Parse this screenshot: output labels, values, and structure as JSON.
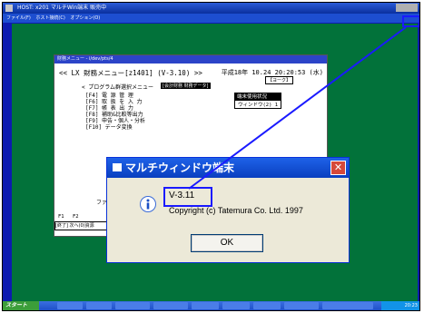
{
  "outer_window": {
    "title": "HOST: x201    マルチWin端末 販売中",
    "menu": [
      "ファイル(F)",
      "ホスト接続(C)",
      "オプション(O)"
    ]
  },
  "terminal": {
    "title": "財務メニュー - i/dev/pts/4",
    "header": "<< LX 財務メニュー[z1401] (V-3.10) >>",
    "datetime": "平成18年 10.24 20:20:53 (水)",
    "box_label": "【ヨーク】",
    "submenu": "< プログラム群選択メニュー",
    "submenu_tag": "[会計財務 財務データ]",
    "menu_items": [
      "[F4] 電 源 管 理",
      "[F6] 取 扱 を 入 力",
      "[F7] 帳 表 出 力",
      "[F8] 補助&比較等出力",
      "[F9] 申告・個人・分析",
      "[F10] データ変換"
    ],
    "status_header": "端末使用状況",
    "status_row": "ウィンドウ(2)",
    "status_value": "1",
    "fa_label": "ファ",
    "f1_label": "F1",
    "f2_label": "F2",
    "bottom_text": "[終了] 次へ(0)資源"
  },
  "dialog": {
    "title": "マルチウィンドウ端末",
    "version": "V-3.11",
    "copyright": "Copyright (c) Tatemura Co. Ltd. 1997",
    "ok_label": "OK"
  },
  "taskbar": {
    "start_label": "スタート",
    "clock": "20:23"
  },
  "colors": {
    "desktop": "#0d1bb0",
    "green_panel": "#02723a",
    "annotation": "#1a1aff"
  }
}
